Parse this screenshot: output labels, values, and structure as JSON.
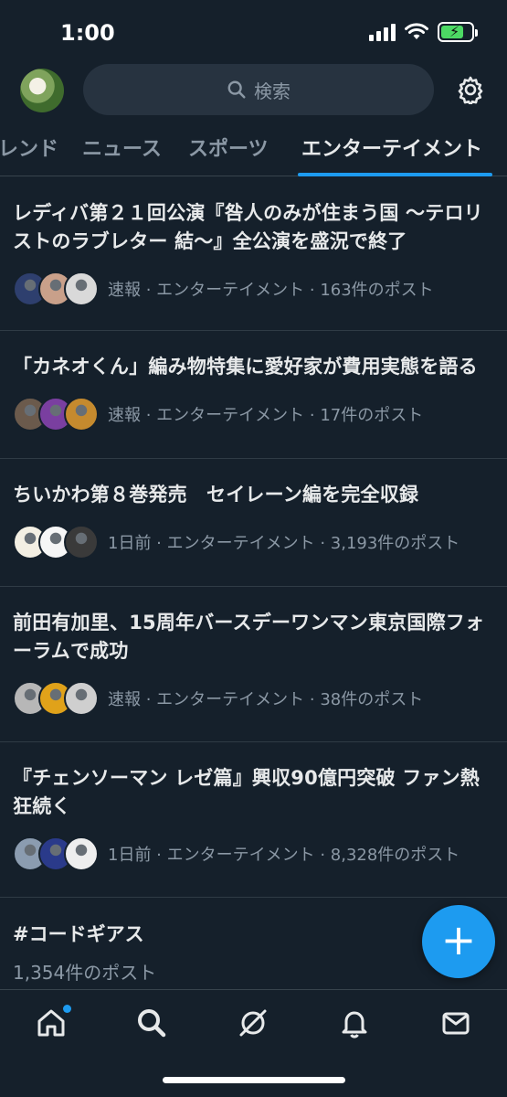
{
  "status": {
    "time": "1:00"
  },
  "header": {
    "search_placeholder": "検索"
  },
  "tabs": [
    {
      "label": "レンド"
    },
    {
      "label": "ニュース"
    },
    {
      "label": "スポーツ"
    },
    {
      "label": "エンターテイメント",
      "active": true
    }
  ],
  "feed": [
    {
      "title": "レディバ第２１回公演『咎人のみが住まう国 〜テロリストのラブレター 結〜』全公演を盛況で終了",
      "meta": "速報 · エンターテイメント · 163件のポスト",
      "faces": [
        "#2e3f6e",
        "#c9a08a",
        "#d9d9d9"
      ]
    },
    {
      "title": "「カネオくん」編み物特集に愛好家が費用実態を語る",
      "meta": "速報 · エンターテイメント · 17件のポスト",
      "faces": [
        "#6b5a4c",
        "#7a3fa0",
        "#c58a2e"
      ]
    },
    {
      "title": "ちいかわ第８巻発売　セイレーン編を完全収録",
      "meta": "1日前 · エンターテイメント · 3,193件のポスト",
      "faces": [
        "#f3efe3",
        "#f6f6f6",
        "#3a3a3a"
      ]
    },
    {
      "title": "前田有加里、15周年バースデーワンマン東京国際フォーラムで成功",
      "meta": "速報 · エンターテイメント · 38件のポスト",
      "faces": [
        "#b7b7b7",
        "#e0a21a",
        "#cfcfcf"
      ]
    },
    {
      "title": "『チェンソーマン レゼ篇』興収90億円突破 ファン熱狂続く",
      "meta": "1日前 · エンターテイメント · 8,328件のポスト",
      "faces": [
        "#8b9cb0",
        "#2a3a8a",
        "#eeeeee"
      ]
    }
  ],
  "last_item": {
    "title": "#コードギアス",
    "subtitle": "1,354件のポスト"
  },
  "fab": {
    "label": "+"
  },
  "colors": {
    "accent": "#1d9bf0",
    "background": "#15202b"
  }
}
